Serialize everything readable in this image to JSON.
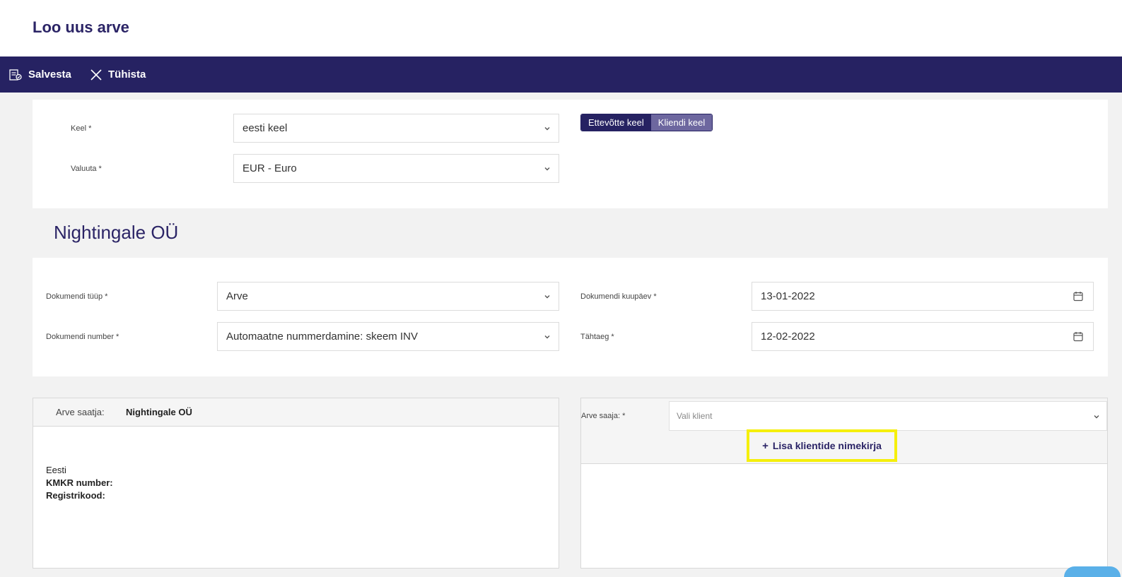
{
  "page": {
    "title": "Loo uus arve"
  },
  "toolbar": {
    "save_label": "Salvesta",
    "cancel_label": "Tühista"
  },
  "settings": {
    "language_label": "Keel *",
    "language_value": "eesti keel",
    "currency_label": "Valuuta *",
    "currency_value": "EUR - Euro",
    "lang_toggle": {
      "company": "Ettevõtte keel",
      "client": "Kliendi keel",
      "selected": "company"
    }
  },
  "company": {
    "name": "Nightingale OÜ"
  },
  "document": {
    "type_label": "Dokumendi tüüp *",
    "type_value": "Arve",
    "number_label": "Dokumendi number *",
    "number_value": "Automaatne nummerdamine: skeem INV",
    "date_label": "Dokumendi kuupäev *",
    "date_value": "13-01-2022",
    "due_label": "Tähtaeg *",
    "due_value": "12-02-2022"
  },
  "sender": {
    "label": "Arve saatja:",
    "name": "Nightingale OÜ",
    "country": "Eesti",
    "vat_label": "KMKR number:",
    "reg_label": "Registrikood:"
  },
  "receiver": {
    "label": "Arve saaja: *",
    "placeholder": "Vali klient",
    "add_button": "Lisa klientide nimekirja"
  },
  "colors": {
    "primary": "#262262",
    "accent_inactive": "#6d679f",
    "highlight": "#f5ef0c"
  }
}
